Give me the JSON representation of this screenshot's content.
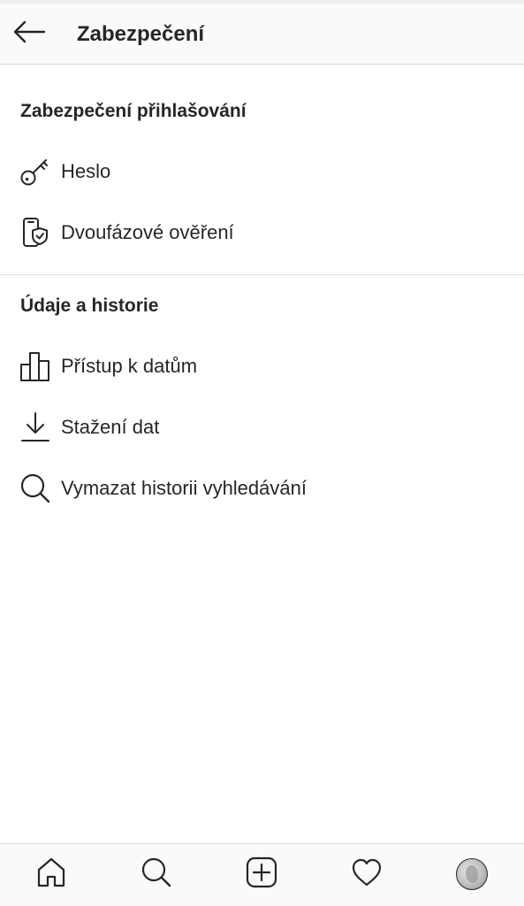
{
  "header": {
    "title": "Zabezpečení"
  },
  "sections": [
    {
      "title": "Zabezpečení přihlašování",
      "items": [
        {
          "label": "Heslo",
          "icon": "key-icon"
        },
        {
          "label": "Dvoufázové ověření",
          "icon": "phone-shield-icon"
        }
      ]
    },
    {
      "title": "Údaje a historie",
      "items": [
        {
          "label": "Přístup k datům",
          "icon": "bar-chart-icon"
        },
        {
          "label": "Stažení dat",
          "icon": "download-icon"
        },
        {
          "label": "Vymazat historii vyhledávání",
          "icon": "search-icon"
        }
      ]
    }
  ],
  "bottom_nav": {
    "items": [
      "home-icon",
      "search-icon",
      "new-post-icon",
      "heart-icon",
      "profile-avatar"
    ]
  },
  "colors": {
    "text": "#262626",
    "background": "#ffffff",
    "bar_background": "#fafafa",
    "divider": "#dbdbdb"
  }
}
